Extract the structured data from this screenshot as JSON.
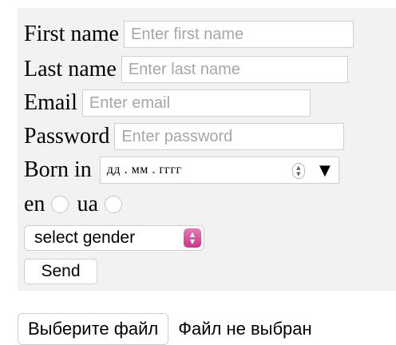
{
  "form": {
    "first_name": {
      "label": "First name",
      "placeholder": "Enter first name",
      "value": ""
    },
    "last_name": {
      "label": "Last name",
      "placeholder": "Enter last name",
      "value": ""
    },
    "email": {
      "label": "Email",
      "placeholder": "Enter email",
      "value": ""
    },
    "password": {
      "label": "Password",
      "placeholder": "Enter password",
      "value": ""
    },
    "born_in": {
      "label": "Born in",
      "value": "дд . мм . гггг",
      "spinner_icon": "stepper-arrows-icon",
      "dropdown_icon": "triangle-down-icon"
    },
    "language": {
      "options": [
        {
          "label": "en",
          "checked": false
        },
        {
          "label": "ua",
          "checked": false
        }
      ]
    },
    "gender_select": {
      "selected": "select gender",
      "arrow_icon": "select-arrows-icon",
      "accent_color": "#d14a9d"
    },
    "send_label": "Send"
  },
  "file_upload": {
    "button_label": "Выберите файл",
    "status": "Файл не выбран"
  },
  "colors": {
    "panel_background": "#f2f2f2",
    "placeholder_text": "#a6a6a6",
    "input_border": "#cfcfcf"
  }
}
